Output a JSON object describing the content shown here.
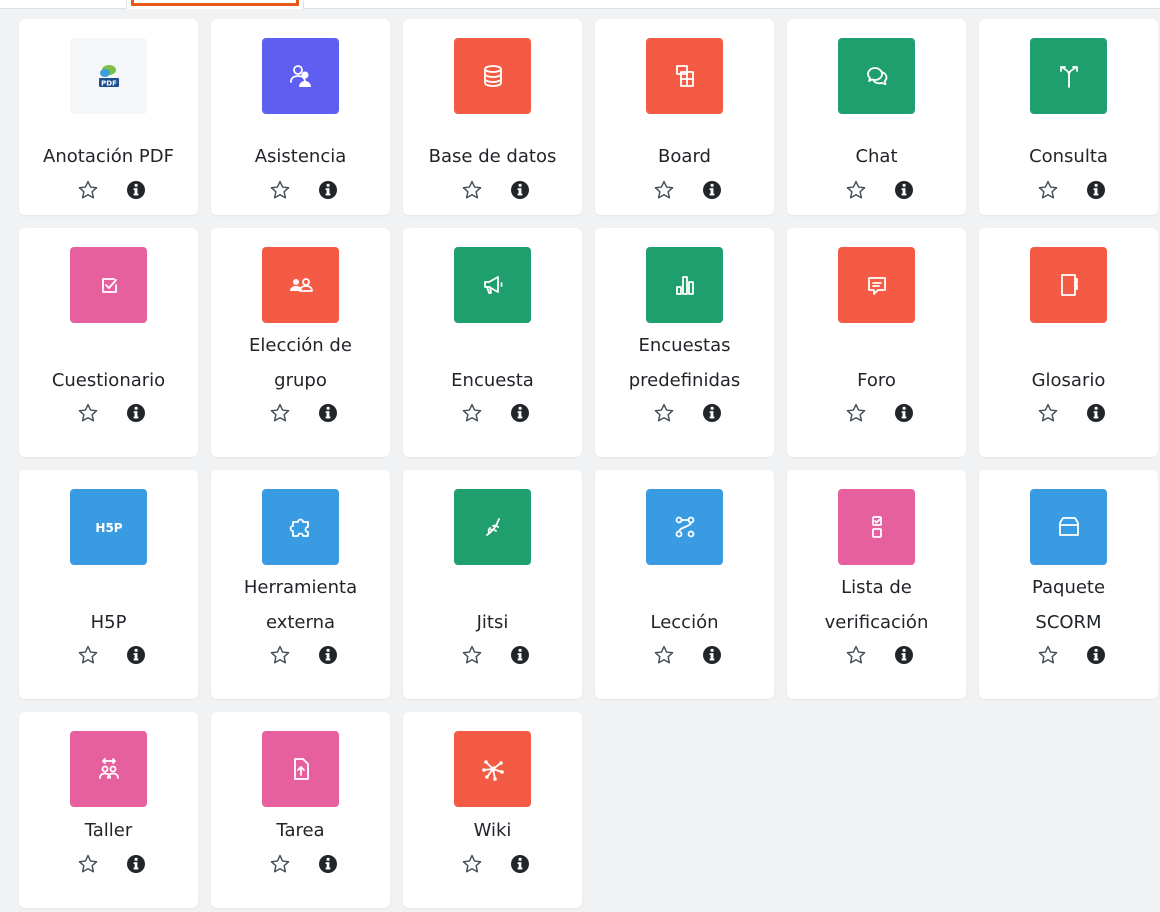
{
  "colors": {
    "pink": "#e6609e",
    "red": "#f35b45",
    "green": "#1f9f6e",
    "blue": "#399be2",
    "indigo": "#5e5ef0",
    "star": "#495057",
    "info": "#212529"
  },
  "modules": [
    {
      "label": "Anotación PDF",
      "icon": "pdf-annotation-icon",
      "color": "none"
    },
    {
      "label": "Asistencia",
      "icon": "attendance-icon",
      "color": "indigo"
    },
    {
      "label": "Base de datos",
      "icon": "database-icon",
      "color": "red"
    },
    {
      "label": "Board",
      "icon": "board-icon",
      "color": "red"
    },
    {
      "label": "Chat",
      "icon": "chat-icon",
      "color": "green"
    },
    {
      "label": "Consulta",
      "icon": "choice-icon",
      "color": "green"
    },
    {
      "label": "Cuestionario",
      "icon": "quiz-icon",
      "color": "pink"
    },
    {
      "label": "Elección de grupo",
      "icon": "group-choice-icon",
      "color": "red"
    },
    {
      "label": "Encuesta",
      "icon": "survey-icon",
      "color": "green"
    },
    {
      "label": "Encuestas predefinidas",
      "icon": "predefined-survey-icon",
      "color": "green"
    },
    {
      "label": "Foro",
      "icon": "forum-icon",
      "color": "red"
    },
    {
      "label": "Glosario",
      "icon": "glossary-icon",
      "color": "red"
    },
    {
      "label": "H5P",
      "icon": "h5p-icon",
      "color": "blue"
    },
    {
      "label": "Herramienta externa",
      "icon": "external-tool-icon",
      "color": "blue"
    },
    {
      "label": "Jitsi",
      "icon": "jitsi-icon",
      "color": "green"
    },
    {
      "label": "Lección",
      "icon": "lesson-icon",
      "color": "blue"
    },
    {
      "label": "Lista de verificación",
      "icon": "checklist-icon",
      "color": "pink"
    },
    {
      "label": "Paquete SCORM",
      "icon": "scorm-package-icon",
      "color": "blue"
    },
    {
      "label": "Taller",
      "icon": "workshop-icon",
      "color": "pink"
    },
    {
      "label": "Tarea",
      "icon": "assignment-icon",
      "color": "pink"
    },
    {
      "label": "Wiki",
      "icon": "wiki-icon",
      "color": "red"
    }
  ]
}
